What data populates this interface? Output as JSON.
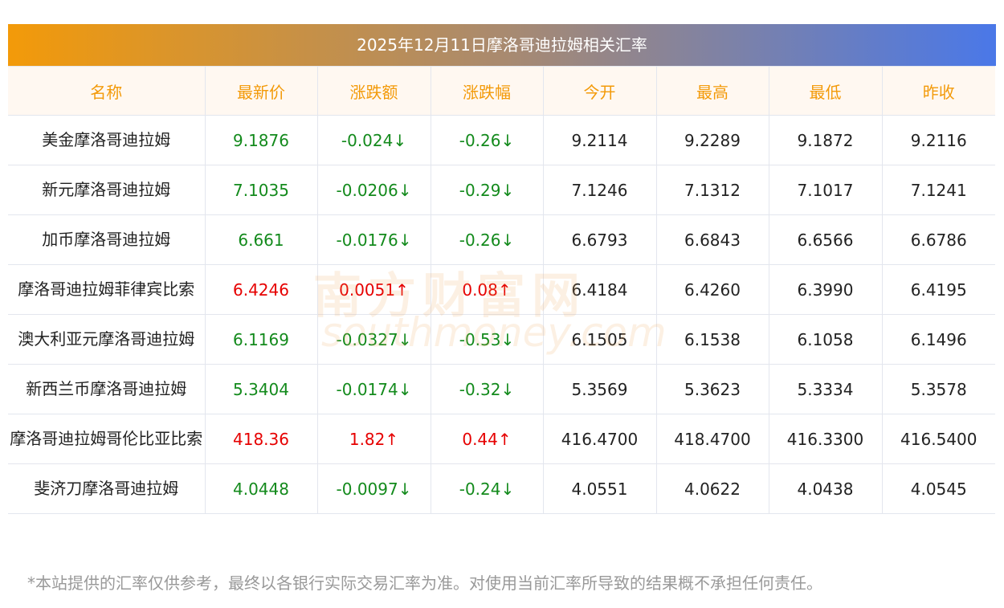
{
  "title": "2025年12月11日摩洛哥迪拉姆相关汇率",
  "headers": [
    "名称",
    "最新价",
    "涨跌额",
    "涨跌幅",
    "今开",
    "最高",
    "最低",
    "昨收"
  ],
  "rows": [
    {
      "name": "美金摩洛哥迪拉姆",
      "latest": "9.1876",
      "change": "-0.024↓",
      "pct": "-0.26↓",
      "open": "9.2114",
      "high": "9.2289",
      "low": "9.1872",
      "prev": "9.2116",
      "dir": "down"
    },
    {
      "name": "新元摩洛哥迪拉姆",
      "latest": "7.1035",
      "change": "-0.0206↓",
      "pct": "-0.29↓",
      "open": "7.1246",
      "high": "7.1312",
      "low": "7.1017",
      "prev": "7.1241",
      "dir": "down"
    },
    {
      "name": "加币摩洛哥迪拉姆",
      "latest": "6.661",
      "change": "-0.0176↓",
      "pct": "-0.26↓",
      "open": "6.6793",
      "high": "6.6843",
      "low": "6.6566",
      "prev": "6.6786",
      "dir": "down"
    },
    {
      "name": "摩洛哥迪拉姆菲律宾比索",
      "latest": "6.4246",
      "change": "0.0051↑",
      "pct": "0.08↑",
      "open": "6.4184",
      "high": "6.4260",
      "low": "6.3990",
      "prev": "6.4195",
      "dir": "up"
    },
    {
      "name": "澳大利亚元摩洛哥迪拉姆",
      "latest": "6.1169",
      "change": "-0.0327↓",
      "pct": "-0.53↓",
      "open": "6.1505",
      "high": "6.1538",
      "low": "6.1058",
      "prev": "6.1496",
      "dir": "down"
    },
    {
      "name": "新西兰币摩洛哥迪拉姆",
      "latest": "5.3404",
      "change": "-0.0174↓",
      "pct": "-0.32↓",
      "open": "5.3569",
      "high": "5.3623",
      "low": "5.3334",
      "prev": "5.3578",
      "dir": "down"
    },
    {
      "name": "摩洛哥迪拉姆哥伦比亚比索",
      "latest": "418.36",
      "change": "1.82↑",
      "pct": "0.44↑",
      "open": "416.4700",
      "high": "418.4700",
      "low": "416.3300",
      "prev": "416.5400",
      "dir": "up"
    },
    {
      "name": "斐济刀摩洛哥迪拉姆",
      "latest": "4.0448",
      "change": "-0.0097↓",
      "pct": "-0.24↓",
      "open": "4.0551",
      "high": "4.0622",
      "low": "4.0438",
      "prev": "4.0545",
      "dir": "down"
    }
  ],
  "watermark": "南方财富网 southmoney.com",
  "disclaimer": "*本站提供的汇率仅供参考，最终以各银行实际交易汇率为准。对使用当前汇率所导致的结果概不承担任何责任。"
}
